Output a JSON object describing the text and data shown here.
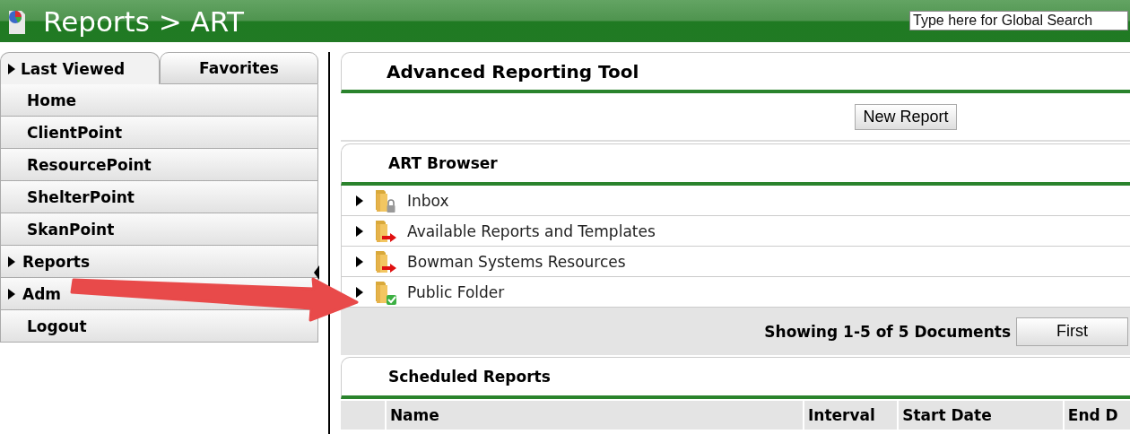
{
  "header": {
    "title": "Reports > ART",
    "search": {
      "placeholder": "Type here for Global Search"
    }
  },
  "sidebar": {
    "tabs": [
      {
        "label": "Last Viewed",
        "selected": true,
        "expandable": true
      },
      {
        "label": "Favorites",
        "selected": false,
        "expandable": false
      }
    ],
    "items": [
      {
        "label": "Home",
        "expandable": false
      },
      {
        "label": "ClientPoint",
        "expandable": false
      },
      {
        "label": "ResourcePoint",
        "expandable": false
      },
      {
        "label": "ShelterPoint",
        "expandable": false
      },
      {
        "label": "SkanPoint",
        "expandable": false
      },
      {
        "label": "Reports",
        "expandable": true
      },
      {
        "label": "Adm",
        "expandable": true
      },
      {
        "label": "Logout",
        "expandable": false
      }
    ]
  },
  "main": {
    "title": "Advanced Reporting Tool",
    "new_report_button": "New Report",
    "browser": {
      "title": "ART Browser",
      "folders": [
        {
          "name": "Inbox",
          "kind": "locked"
        },
        {
          "name": "Available Reports and Templates",
          "kind": "shortcut"
        },
        {
          "name": "Bowman Systems Resources",
          "kind": "shortcut"
        },
        {
          "name": "Public Folder",
          "kind": "shared"
        }
      ],
      "pager": {
        "summary": "Showing 1-5 of 5 Documents",
        "first_button": "First"
      }
    },
    "scheduled": {
      "title": "Scheduled Reports",
      "columns": [
        "Name",
        "Interval",
        "Start Date",
        "End D"
      ]
    }
  }
}
